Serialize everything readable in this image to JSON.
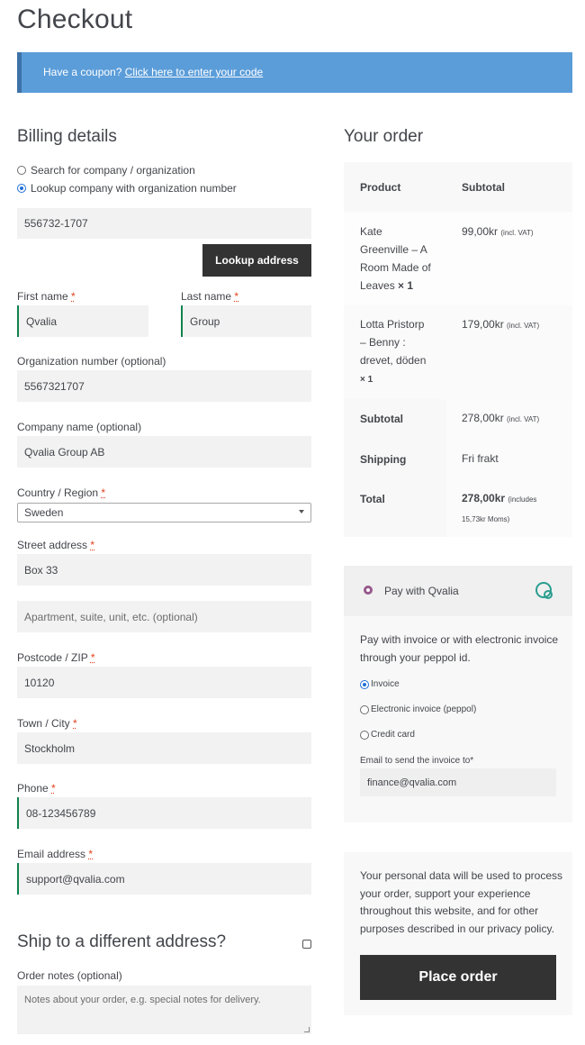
{
  "page": {
    "title": "Checkout"
  },
  "coupon": {
    "prefix": "Have a coupon?",
    "link": "Click here to enter your code"
  },
  "billing": {
    "title": "Billing details",
    "radio_search": "Search for company / organization",
    "radio_lookup": "Lookup company with organization number",
    "org_lookup_value": "556732-1707",
    "lookup_button": "Lookup address",
    "first_name_label": "First name",
    "first_name_value": "Qvalia",
    "last_name_label": "Last name",
    "last_name_value": "Group",
    "org_number_label": "Organization number (optional)",
    "org_number_value": "5567321707",
    "company_label": "Company name (optional)",
    "company_value": "Qvalia Group AB",
    "country_label": "Country / Region",
    "country_value": "Sweden",
    "street_label": "Street address",
    "street_value": "Box 33",
    "street2_placeholder": "Apartment, suite, unit, etc. (optional)",
    "postcode_label": "Postcode / ZIP",
    "postcode_value": "10120",
    "city_label": "Town / City",
    "city_value": "Stockholm",
    "phone_label": "Phone",
    "phone_value": "08-123456789",
    "email_label": "Email address",
    "email_value": "support@qvalia.com",
    "required_mark": "*"
  },
  "shipping": {
    "title": "Ship to a different address?",
    "notes_label": "Order notes (optional)",
    "notes_placeholder": "Notes about your order, e.g. special notes for delivery."
  },
  "order": {
    "title": "Your order",
    "col_product": "Product",
    "col_subtotal": "Subtotal",
    "items": [
      {
        "name_lines": [
          "Kate",
          "Greenville – A",
          "Room Made of"
        ],
        "last_line": "Leaves",
        "qty": "× 1",
        "price": "99,00kr",
        "vat": "(incl. VAT)"
      },
      {
        "name_lines": [
          "Lotta Pristorp",
          "– Benny :",
          "drevet, döden"
        ],
        "qty": "× 1",
        "price": "179,00kr",
        "vat": "(incl. VAT)"
      }
    ],
    "subtotal_label": "Subtotal",
    "subtotal_value": "278,00kr",
    "subtotal_vat": "(incl. VAT)",
    "shipping_label": "Shipping",
    "shipping_value": "Fri frakt",
    "total_label": "Total",
    "total_value": "278,00kr",
    "total_note_1": "(includes",
    "total_note_2": "15,73kr Moms)"
  },
  "payment": {
    "method": "Pay with Qvalia",
    "description_1": "Pay with invoice or with electronic invoice",
    "description_2": "through your peppol id.",
    "opt_invoice": "Invoice",
    "opt_einvoice": "Electronic invoice (peppol)",
    "opt_card": "Credit card",
    "email_label": "Email to send the invoice to*",
    "email_value": "finance@qvalia.com"
  },
  "privacy": {
    "line1": "Your personal data will be used to process",
    "line2": "your order, support your experience",
    "line3": "throughout this website, and for other",
    "line4_prefix": "purposes described in our ",
    "link": "privacy policy",
    "line4_suffix": ".",
    "place_order": "Place order"
  },
  "colors": {
    "accent": "#96588a",
    "coupon_bg": "#5b9dd9",
    "button": "#333333",
    "valid": "#0f834d"
  }
}
